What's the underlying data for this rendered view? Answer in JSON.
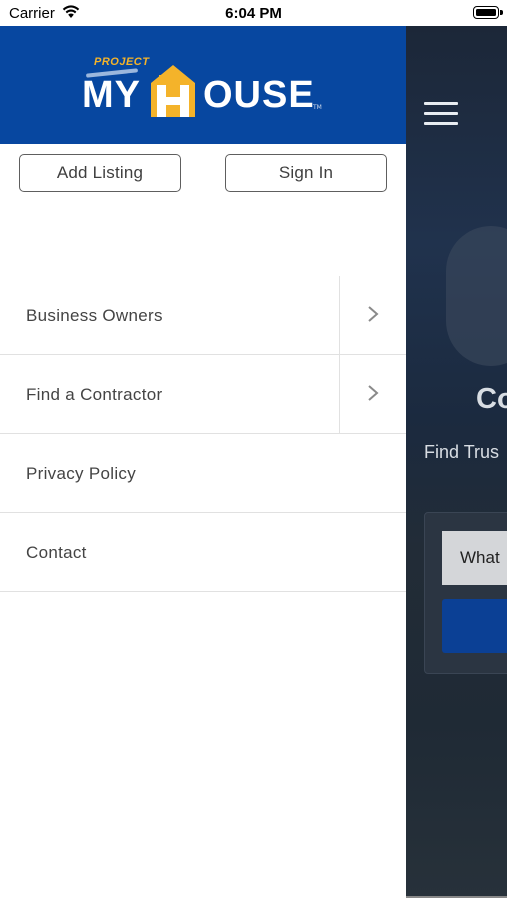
{
  "status_bar": {
    "carrier": "Carrier",
    "time": "6:04 PM",
    "wifi_icon": "wifi-icon",
    "battery_icon": "battery-icon"
  },
  "drawer": {
    "logo": {
      "project_text": "PROJECT",
      "word_left": "MY",
      "word_right": "OUSE"
    },
    "buttons": {
      "add_listing": "Add Listing",
      "sign_in": "Sign In"
    },
    "menu": [
      {
        "label": "Business Owners",
        "has_chevron": true
      },
      {
        "label": "Find a Contractor",
        "has_chevron": true
      },
      {
        "label": "Privacy Policy",
        "has_chevron": false
      },
      {
        "label": "Contact",
        "has_chevron": false
      }
    ]
  },
  "background_screen": {
    "title_fragment": "Co",
    "subtitle_fragment": "Find Trus",
    "search_placeholder_fragment": "What",
    "menu_icon": "hamburger-icon"
  },
  "colors": {
    "brand_blue": "#0747a0",
    "logo_orange": "#f4b32a",
    "button_blue": "#0b4095"
  }
}
